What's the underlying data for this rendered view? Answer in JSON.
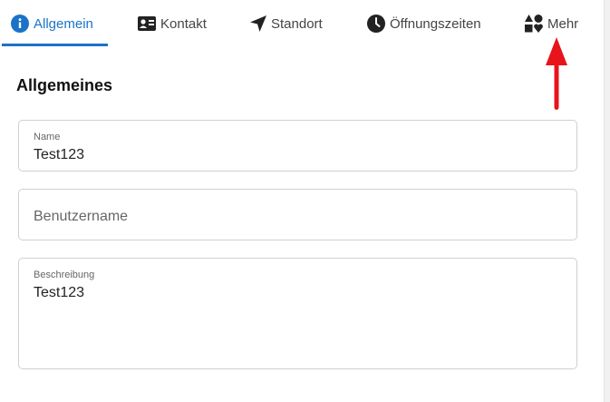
{
  "tabs": [
    {
      "label": "Allgemein",
      "icon": "info-circle-icon",
      "active": true
    },
    {
      "label": "Kontakt",
      "icon": "contact-card-icon",
      "active": false
    },
    {
      "label": "Standort",
      "icon": "location-arrow-icon",
      "active": false
    },
    {
      "label": "Öffnungszeiten",
      "icon": "clock-icon",
      "active": false
    },
    {
      "label": "Mehr",
      "icon": "shapes-icon",
      "active": false
    }
  ],
  "section": {
    "title": "Allgemeines"
  },
  "fields": {
    "name": {
      "label": "Name",
      "value": "Test123"
    },
    "username": {
      "placeholder": "Benutzername",
      "value": ""
    },
    "description": {
      "label": "Beschreibung",
      "value": "Test123"
    }
  },
  "colors": {
    "accent": "#1a73c8",
    "annotation_arrow": "#e8141b"
  }
}
